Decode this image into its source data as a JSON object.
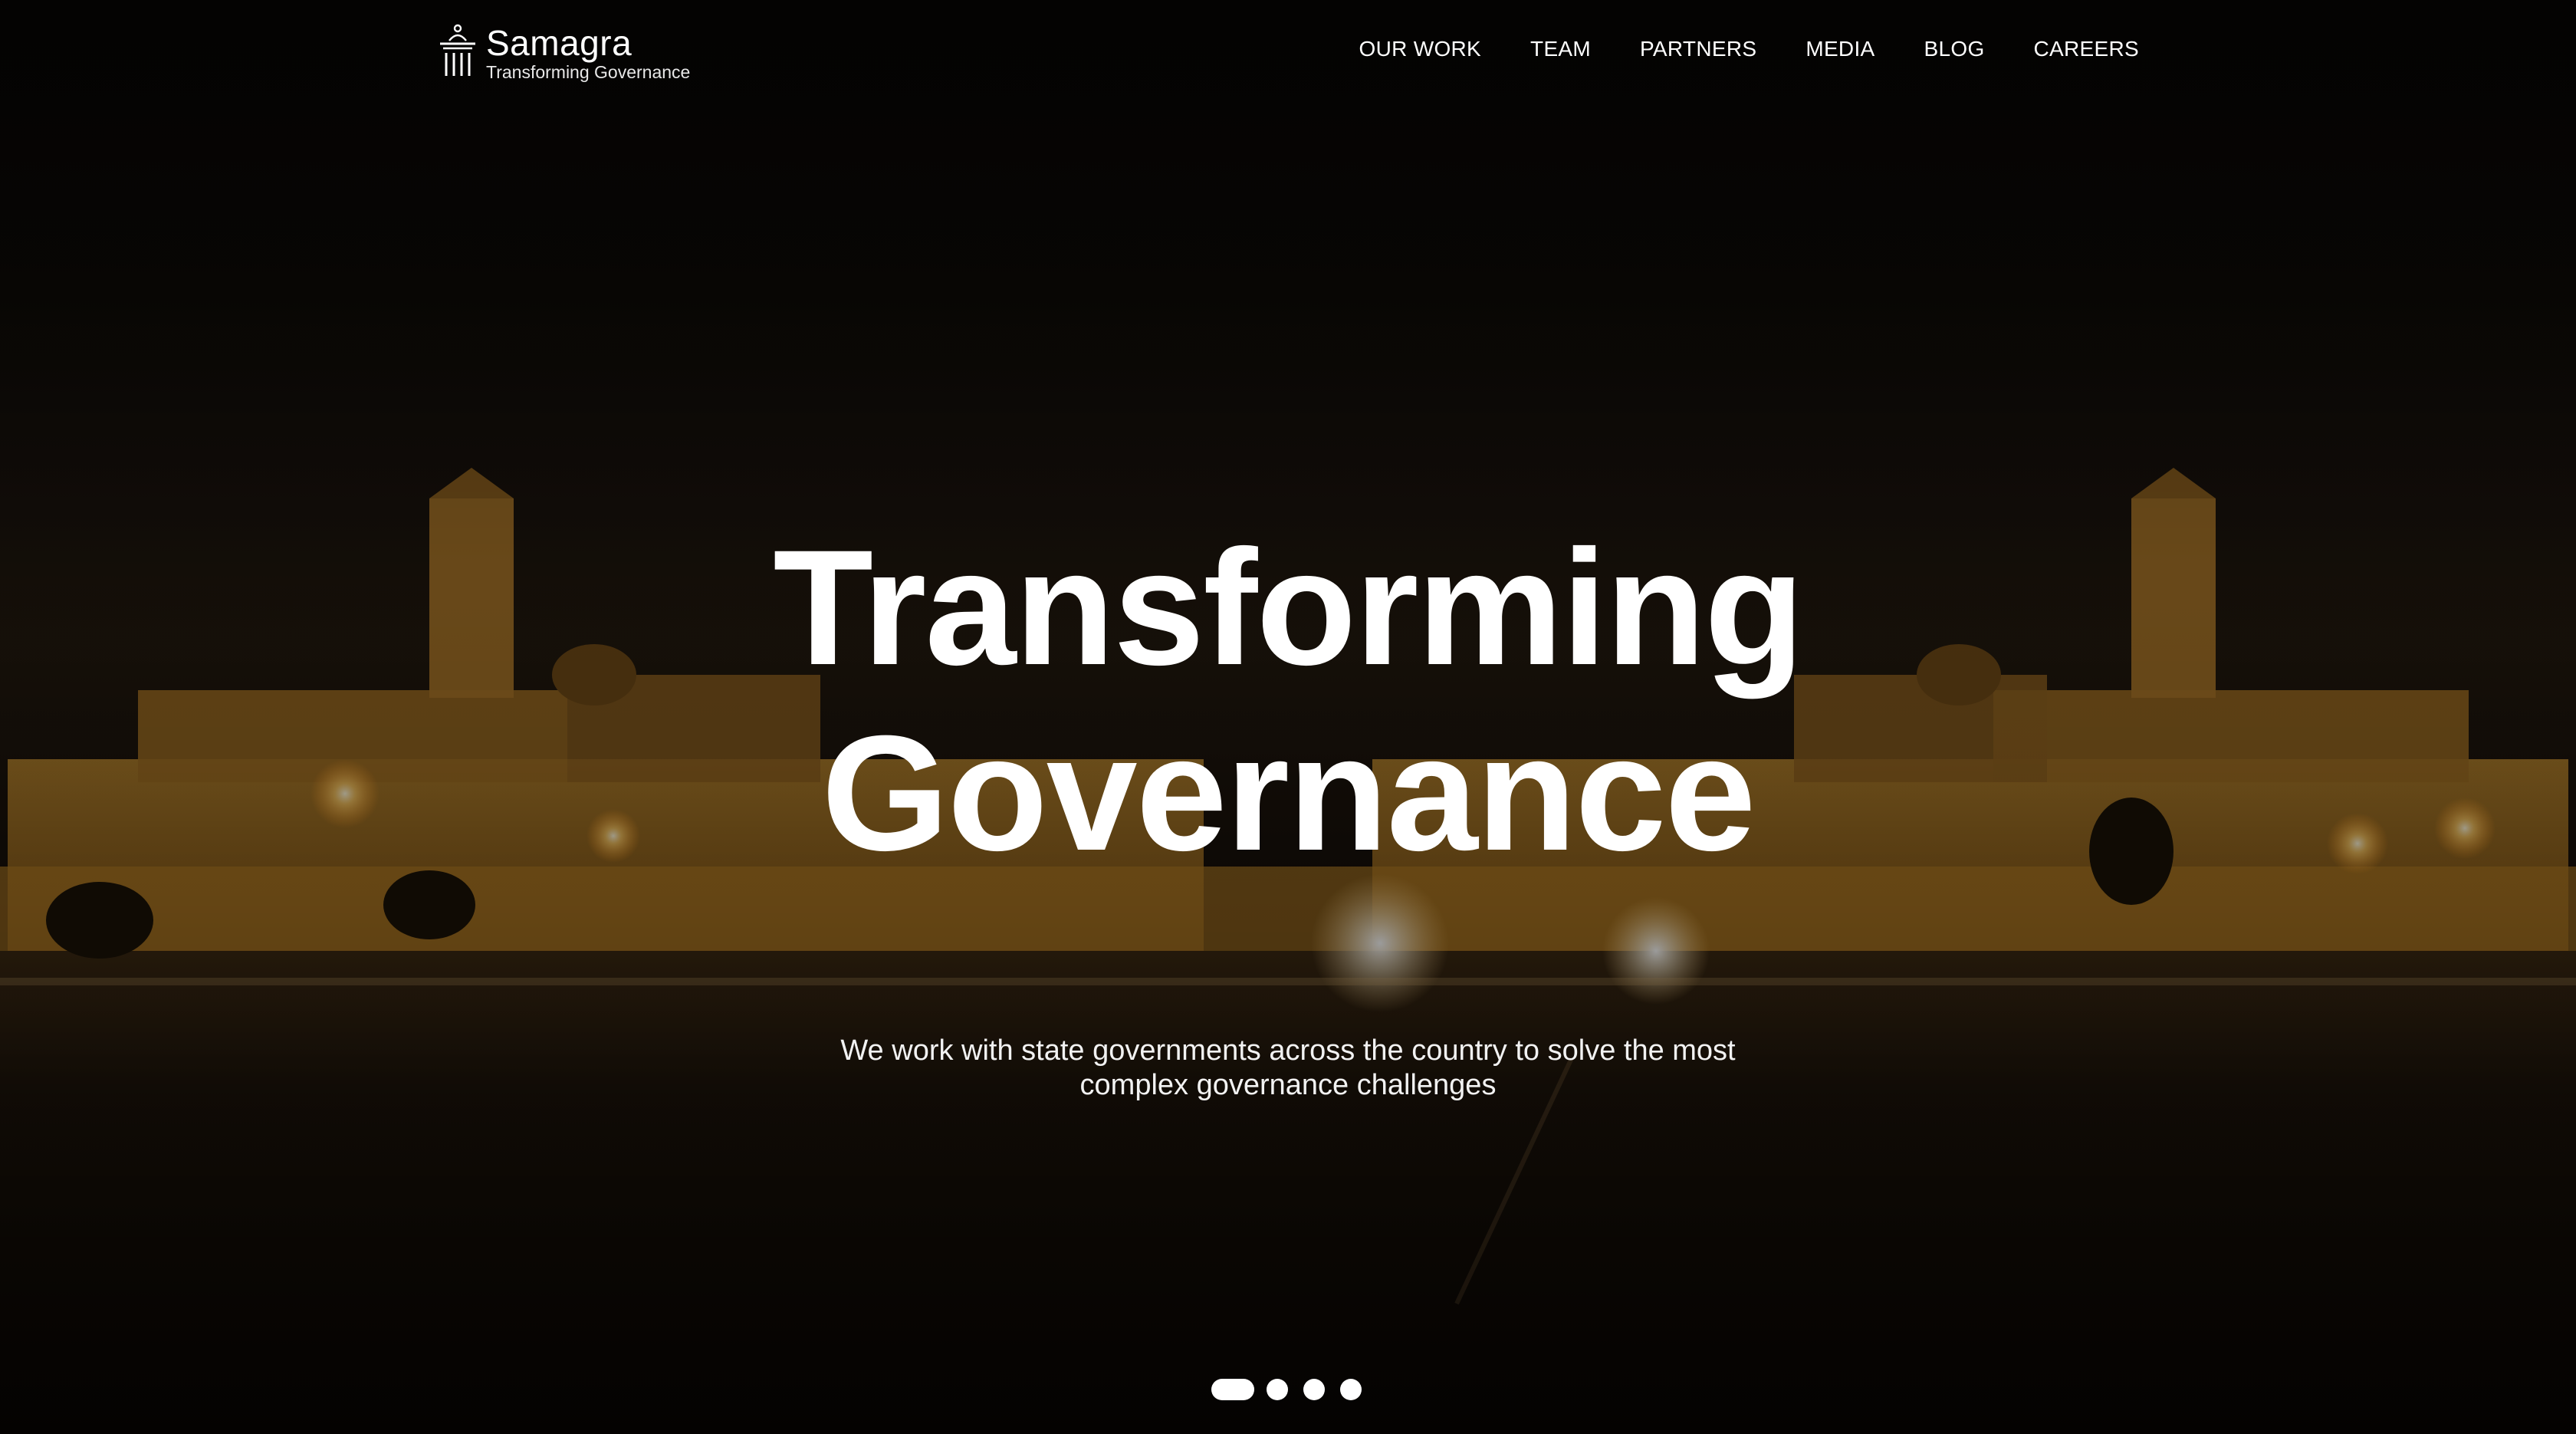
{
  "brand": {
    "name": "Samagra",
    "tagline": "Transforming Governance",
    "icon": "pillar-logo-icon"
  },
  "nav": {
    "items": [
      {
        "label": "OUR WORK"
      },
      {
        "label": "TEAM"
      },
      {
        "label": "PARTNERS"
      },
      {
        "label": "MEDIA"
      },
      {
        "label": "BLOG"
      },
      {
        "label": "CAREERS"
      }
    ]
  },
  "hero": {
    "headline_line1": "Transforming",
    "headline_line2": "Governance",
    "subtitle": "We work with state governments across the country to solve the most complex governance challenges",
    "background": "night-view-of-government-buildings"
  },
  "carousel": {
    "slide_count": 4,
    "active_index": 0
  },
  "colors": {
    "text": "#ffffff",
    "building_glow": "#d9a23c",
    "sky": "#0b0705"
  }
}
